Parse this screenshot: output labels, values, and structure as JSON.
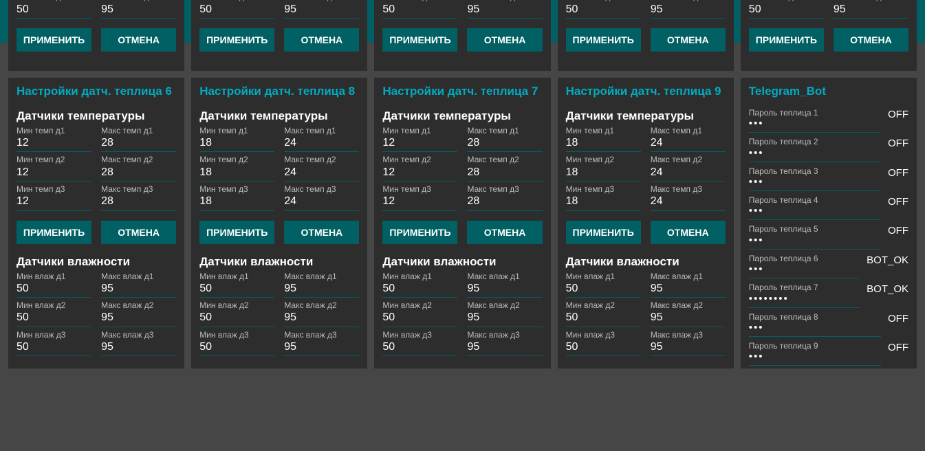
{
  "header": {
    "title": "Настройки"
  },
  "labels": {
    "apply": "ПРИМЕНИТЬ",
    "cancel": "ОТМЕНА",
    "temp_title": "Датчики температуры",
    "hum_title": "Датчики влажности",
    "min_t1": "Мин темп д1",
    "max_t1": "Макс темп д1",
    "min_t2": "Мин темп д2",
    "max_t2": "Макс темп д2",
    "min_t3": "Мин темп д3",
    "max_t3": "Макс темп д3",
    "min_h1": "Мин влаж д1",
    "max_h1": "Макс влаж д1",
    "min_h2": "Мин влаж д2",
    "max_h2": "Макс влаж д2",
    "min_h3": "Мин влаж д3",
    "max_h3": "Макс влаж д3"
  },
  "top_row": [
    {
      "min_h3": "50",
      "max_h3": "95"
    },
    {
      "min_h3": "50",
      "max_h3": "95"
    },
    {
      "min_h3": "50",
      "max_h3": "95"
    },
    {
      "min_h3": "50",
      "max_h3": "95"
    },
    {
      "min_h3": "50",
      "max_h3": "95"
    }
  ],
  "cards": [
    {
      "title": "Настройки датч. теплица 6",
      "temp": {
        "d1": [
          "12",
          "28"
        ],
        "d2": [
          "12",
          "28"
        ],
        "d3": [
          "12",
          "28"
        ]
      },
      "hum": {
        "d1": [
          "50",
          "95"
        ],
        "d2": [
          "50",
          "95"
        ],
        "d3": [
          "50",
          "95"
        ]
      }
    },
    {
      "title": "Настройки датч. теплица 8",
      "temp": {
        "d1": [
          "18",
          "24"
        ],
        "d2": [
          "18",
          "24"
        ],
        "d3": [
          "18",
          "24"
        ]
      },
      "hum": {
        "d1": [
          "50",
          "95"
        ],
        "d2": [
          "50",
          "95"
        ],
        "d3": [
          "50",
          "95"
        ]
      }
    },
    {
      "title": "Настройки датч. теплица 7",
      "temp": {
        "d1": [
          "12",
          "28"
        ],
        "d2": [
          "12",
          "28"
        ],
        "d3": [
          "12",
          "28"
        ]
      },
      "hum": {
        "d1": [
          "50",
          "95"
        ],
        "d2": [
          "50",
          "95"
        ],
        "d3": [
          "50",
          "95"
        ]
      }
    },
    {
      "title": "Настройки датч. теплица 9",
      "temp": {
        "d1": [
          "18",
          "24"
        ],
        "d2": [
          "18",
          "24"
        ],
        "d3": [
          "18",
          "24"
        ]
      },
      "hum": {
        "d1": [
          "50",
          "95"
        ],
        "d2": [
          "50",
          "95"
        ],
        "d3": [
          "50",
          "95"
        ]
      }
    }
  ],
  "telegram": {
    "title": "Telegram_Bot",
    "rows": [
      {
        "label": "Пароль теплица 1",
        "value": "•••",
        "status": "OFF"
      },
      {
        "label": "Пароль теплица 2",
        "value": "•••",
        "status": "OFF"
      },
      {
        "label": "Пароль теплица 3",
        "value": "•••",
        "status": "OFF"
      },
      {
        "label": "Пароль теплица 4",
        "value": "•••",
        "status": "OFF"
      },
      {
        "label": "Пароль теплица 5",
        "value": "•••",
        "status": "OFF"
      },
      {
        "label": "Пароль теплица 6",
        "value": "•••",
        "status": "BOT_OK"
      },
      {
        "label": "Пароль теплица 7",
        "value": "••••••••",
        "status": "BOT_OK"
      },
      {
        "label": "Пароль теплица 8",
        "value": "•••",
        "status": "OFF"
      },
      {
        "label": "Пароль теплица 9",
        "value": "•••",
        "status": "OFF"
      }
    ]
  }
}
